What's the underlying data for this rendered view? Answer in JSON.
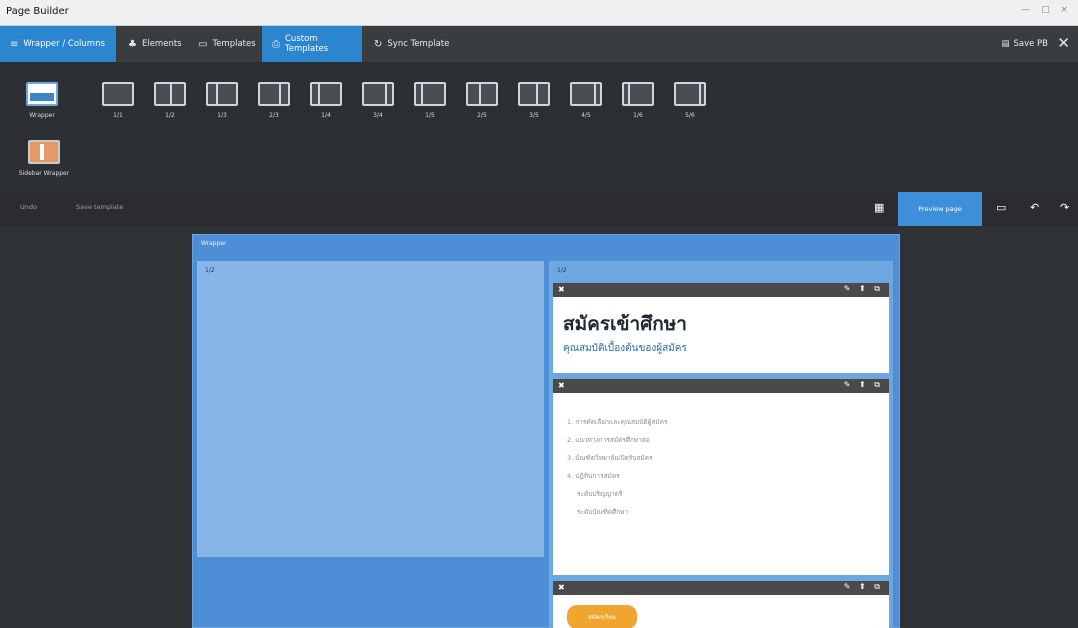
{
  "window": {
    "title": "Page Builder",
    "controls": "— □ ×"
  },
  "menu": {
    "items": [
      {
        "label": "Wrapper / Columns",
        "icon": "≡",
        "active": true
      },
      {
        "label": "Elements",
        "icon": "♣",
        "active": false
      },
      {
        "label": "Templates",
        "icon": "▭",
        "active": false
      },
      {
        "label": "Custom Templates",
        "icon": "⎙",
        "active": true
      },
      {
        "label": "Sync Template",
        "icon": "↻",
        "active": false
      }
    ],
    "save_label": "Save PB",
    "save_icon": "▤",
    "close_icon": "✕"
  },
  "toolbar": {
    "tools": [
      {
        "label": "Wrapper",
        "kind": "wrapper"
      },
      {
        "label": "1/1",
        "kind": "cols",
        "splits": []
      },
      {
        "label": "1/2",
        "kind": "cols",
        "splits": [
          50
        ]
      },
      {
        "label": "1/3",
        "kind": "cols",
        "splits": [
          33
        ]
      },
      {
        "label": "2/3",
        "kind": "cols",
        "splits": [
          66
        ]
      },
      {
        "label": "1/4",
        "kind": "cols",
        "splits": [
          25
        ]
      },
      {
        "label": "3/4",
        "kind": "cols",
        "splits": [
          75
        ]
      },
      {
        "label": "1/5",
        "kind": "cols",
        "splits": [
          20
        ]
      },
      {
        "label": "2/5",
        "kind": "cols",
        "splits": [
          40
        ]
      },
      {
        "label": "3/5",
        "kind": "cols",
        "splits": [
          60
        ]
      },
      {
        "label": "4/5",
        "kind": "cols",
        "splits": [
          80
        ]
      },
      {
        "label": "1/6",
        "kind": "cols",
        "splits": [
          17
        ]
      },
      {
        "label": "5/6",
        "kind": "cols",
        "splits": [
          83
        ]
      },
      {
        "label": "Sidebar Wrapper",
        "kind": "sidebar"
      }
    ]
  },
  "subbar": {
    "left_items": [
      "Undo",
      "Save template"
    ],
    "preview_label": "Preview page",
    "grid_icon": "▦",
    "icons": [
      "▭",
      "↶",
      "↷"
    ]
  },
  "canvas": {
    "wrapper_label": "Wrapper",
    "left_col_label": "1/2",
    "right_col_label": "1/2",
    "block_close": "✖",
    "block_actions": "✎ ⬆ ⧉",
    "heading_block": {
      "title": "สมัครเข้าศึกษา",
      "subtitle": "คุณสมบัติเบื้องต้นของผู้สมัคร"
    },
    "list_block": {
      "rows": [
        "1. การคัดเลือกและคุณสมบัติผู้สมัคร",
        "2. แนวทางการสมัครศึกษาต่อ",
        "3. บัณฑิตวิทยาลัยเปิดรับสมัคร",
        "4. ปฏิทินการสมัคร",
        "ระดับปริญญาตรี",
        "ระดับบัณฑิตศึกษา"
      ]
    },
    "button_block": {
      "label": "สมัครเรียน"
    }
  }
}
